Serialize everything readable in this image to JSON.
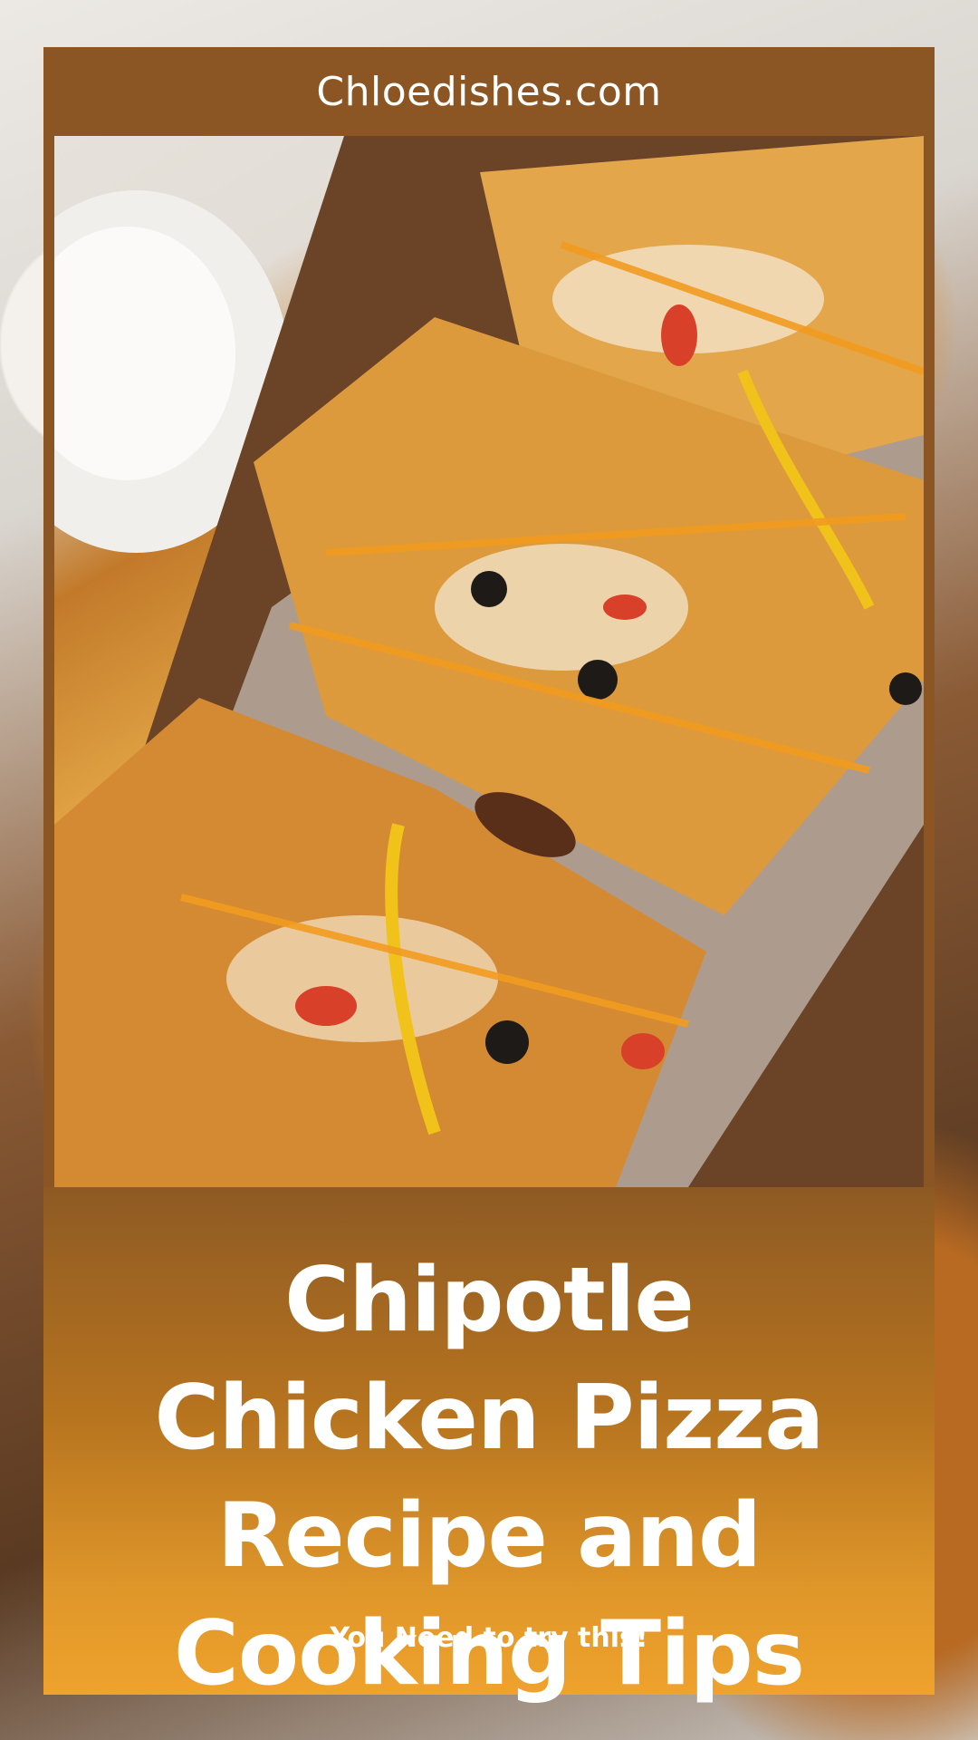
{
  "site": {
    "name": "Chloedishes.com"
  },
  "hero": {
    "image": "chipotle-chicken-pizza-photo"
  },
  "title": "Chipotle Chicken Pizza Recipe and Cooking Tips",
  "tagline": "You Need to try this!",
  "colors": {
    "card": "#8b5623",
    "panel_top": "#8e5a24",
    "panel_bottom": "#efa22c",
    "text": "#ffffff"
  }
}
